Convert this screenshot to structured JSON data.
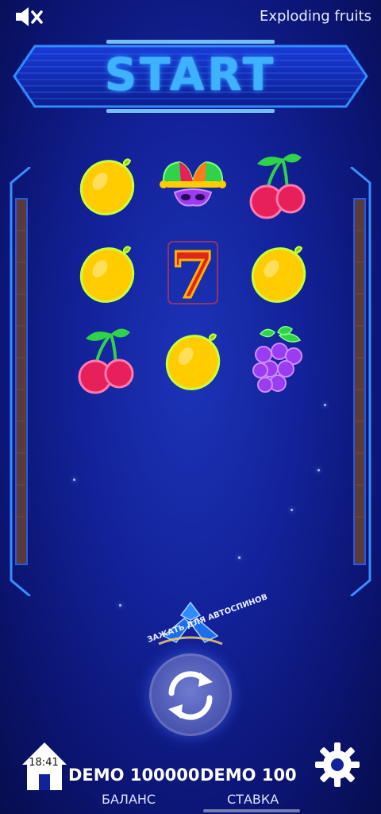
{
  "header": {
    "mute_icon": "speaker-muted-icon",
    "title": "Exploding fruits"
  },
  "start_button": {
    "label": "START"
  },
  "reels": [
    [
      "lemon",
      "jester-hat",
      "cherry"
    ],
    [
      "lemon",
      "seven",
      "lemon"
    ],
    [
      "cherry",
      "lemon",
      "grapes"
    ]
  ],
  "seven_glyph": "7",
  "spin": {
    "autospin_hint": "ЗАЖАТЬ ДЛЯ АВТОСПИНОВ",
    "icon": "refresh-icon"
  },
  "footer": {
    "clock": "18:41",
    "balance_value": "DEMO 100000",
    "balance_label": "БАЛАНС",
    "bet_value": "DEMO 100",
    "bet_label": "СТАВКА",
    "settings_icon": "gear-icon"
  },
  "colors": {
    "background": "#13229a",
    "neon_blue": "#3fb2ff",
    "lemon": "#ffcc00",
    "cherry": "#e8205a",
    "grapes": "#9a3cf0",
    "leaf": "#2fd24a",
    "seven": "#e0261c"
  }
}
